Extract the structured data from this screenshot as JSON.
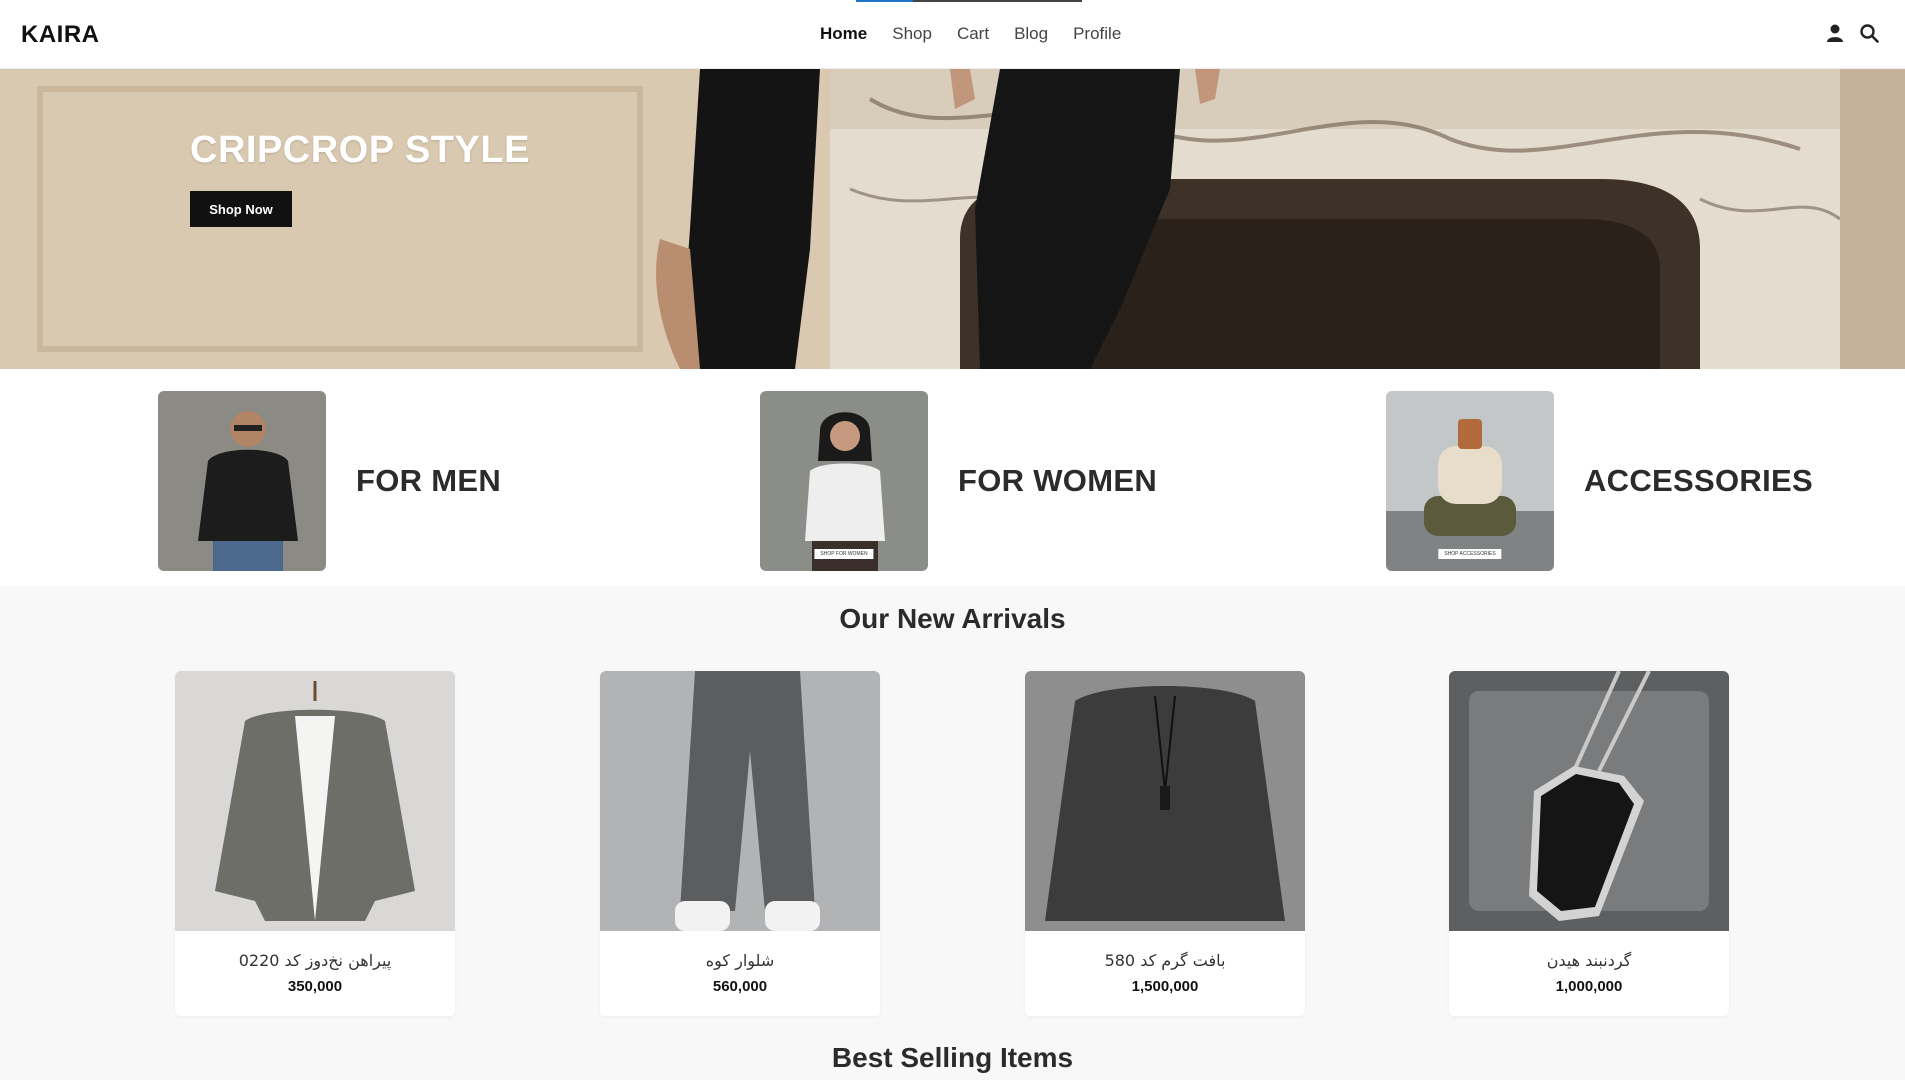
{
  "header": {
    "logo": "KAIRA",
    "nav": [
      {
        "label": "Home",
        "active": true
      },
      {
        "label": "Shop",
        "active": false
      },
      {
        "label": "Cart",
        "active": false
      },
      {
        "label": "Blog",
        "active": false
      },
      {
        "label": "Profile",
        "active": false
      }
    ],
    "icons": [
      "user-icon",
      "search-icon"
    ],
    "progress": 0.25,
    "colors": {
      "progress": "#1f74c9",
      "track": "#444444"
    }
  },
  "hero": {
    "title": "CRIPCROP STYLE",
    "button": "Shop Now"
  },
  "categories": [
    {
      "label": "FOR MEN",
      "tag": ""
    },
    {
      "label": "FOR WOMEN",
      "tag": "SHOP FOR WOMEN"
    },
    {
      "label": "ACCESSORIES",
      "tag": "SHOP ACCESSORIES"
    }
  ],
  "arrivals": {
    "title": "Our New Arrivals",
    "products": [
      {
        "name": "پیراهن نخ‌دوز کد 0220",
        "price": "350,000"
      },
      {
        "name": "شلوار کوه",
        "price": "560,000"
      },
      {
        "name": "بافت گرم کد 580",
        "price": "1,500,000"
      },
      {
        "name": "گردنبند هیدن",
        "price": "1,000,000"
      }
    ]
  },
  "best_selling": {
    "title": "Best Selling Items"
  }
}
